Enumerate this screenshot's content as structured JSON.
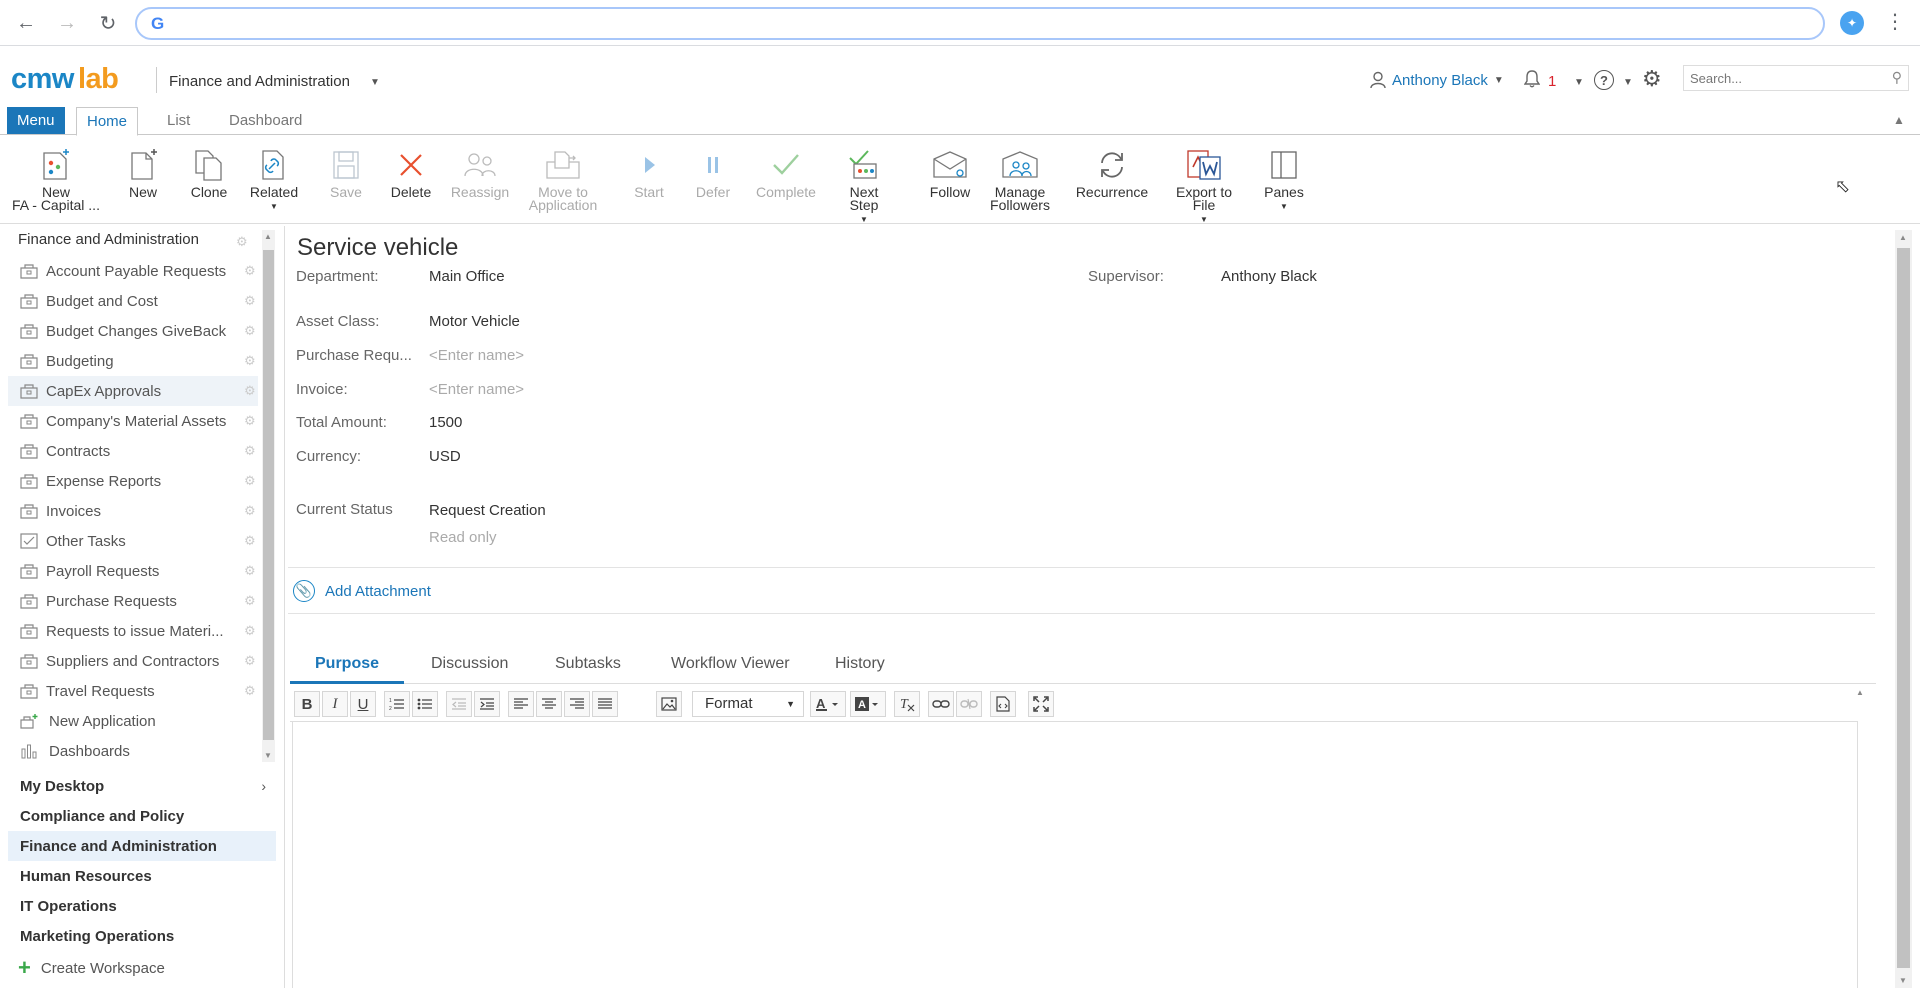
{
  "browser": {
    "back_icon": "arrow-left-icon",
    "forward_icon": "arrow-right-icon",
    "reload_icon": "reload-icon",
    "address_value": ""
  },
  "header": {
    "logo_cmw": "cmw",
    "logo_lab": "lab",
    "app_title": "Finance and Administration",
    "user_name": "Anthony Black",
    "notifications_count": "1",
    "search_placeholder": "Search..."
  },
  "ribbon_tabs": {
    "menu": "Menu",
    "home": "Home",
    "list": "List",
    "dashboard": "Dashboard"
  },
  "ribbon": {
    "new_fa_line1": "New",
    "new_fa_line2": "FA - Capital ...",
    "new": "New",
    "clone": "Clone",
    "related": "Related",
    "save": "Save",
    "delete": "Delete",
    "reassign": "Reassign",
    "move_line1": "Move to",
    "move_line2": "Application",
    "start": "Start",
    "defer": "Defer",
    "complete": "Complete",
    "next_line1": "Next",
    "next_line2": "Step",
    "follow": "Follow",
    "manage_line1": "Manage",
    "manage_line2": "Followers",
    "recurrence": "Recurrence",
    "export_line1": "Export to",
    "export_line2": "File",
    "panes": "Panes"
  },
  "sidebar": {
    "root": "Finance and Administration",
    "items": [
      {
        "label": "Account Payable Requests"
      },
      {
        "label": "Budget and Cost"
      },
      {
        "label": "Budget Changes GiveBack"
      },
      {
        "label": "Budgeting"
      },
      {
        "label": "CapEx Approvals"
      },
      {
        "label": "Company's Material Assets"
      },
      {
        "label": "Contracts"
      },
      {
        "label": "Expense Reports"
      },
      {
        "label": "Invoices"
      },
      {
        "label": "Other Tasks"
      },
      {
        "label": "Payroll Requests"
      },
      {
        "label": "Purchase Requests"
      },
      {
        "label": "Requests to issue Materi..."
      },
      {
        "label": "Suppliers and Contractors"
      },
      {
        "label": "Travel Requests"
      },
      {
        "label": "New Application"
      },
      {
        "label": "Dashboards"
      }
    ],
    "workspaces": [
      {
        "label": "My Desktop"
      },
      {
        "label": "Compliance and Policy"
      },
      {
        "label": "Finance and Administration"
      },
      {
        "label": "Human Resources"
      },
      {
        "label": "IT Operations"
      },
      {
        "label": "Marketing Operations"
      }
    ],
    "create_workspace": "Create Workspace"
  },
  "form": {
    "title": "Service vehicle",
    "department_label": "Department:",
    "department_value": "Main Office",
    "supervisor_label": "Supervisor:",
    "supervisor_value": "Anthony Black",
    "asset_class_label": "Asset Class:",
    "asset_class_value": "Motor Vehicle",
    "purchase_label": "Purchase Requ...",
    "purchase_placeholder": "<Enter name>",
    "invoice_label": "Invoice:",
    "invoice_placeholder": "<Enter name>",
    "total_label": "Total Amount:",
    "total_value": "1500",
    "currency_label": "Currency:",
    "currency_value": "USD",
    "status_label": "Current Status",
    "status_value": "Request Creation",
    "status_note": "Read only",
    "add_attachment": "Add Attachment"
  },
  "tabs": [
    {
      "label": "Purpose"
    },
    {
      "label": "Discussion"
    },
    {
      "label": "Subtasks"
    },
    {
      "label": "Workflow Viewer"
    },
    {
      "label": "History"
    }
  ],
  "editor": {
    "bold": "B",
    "italic": "I",
    "underline": "U",
    "format_label": "Format"
  },
  "colors": {
    "brand_blue": "#1b76b8",
    "brand_orange": "#f39b1e",
    "delete_red": "#e8502e",
    "complete_green": "#5cb85c"
  }
}
